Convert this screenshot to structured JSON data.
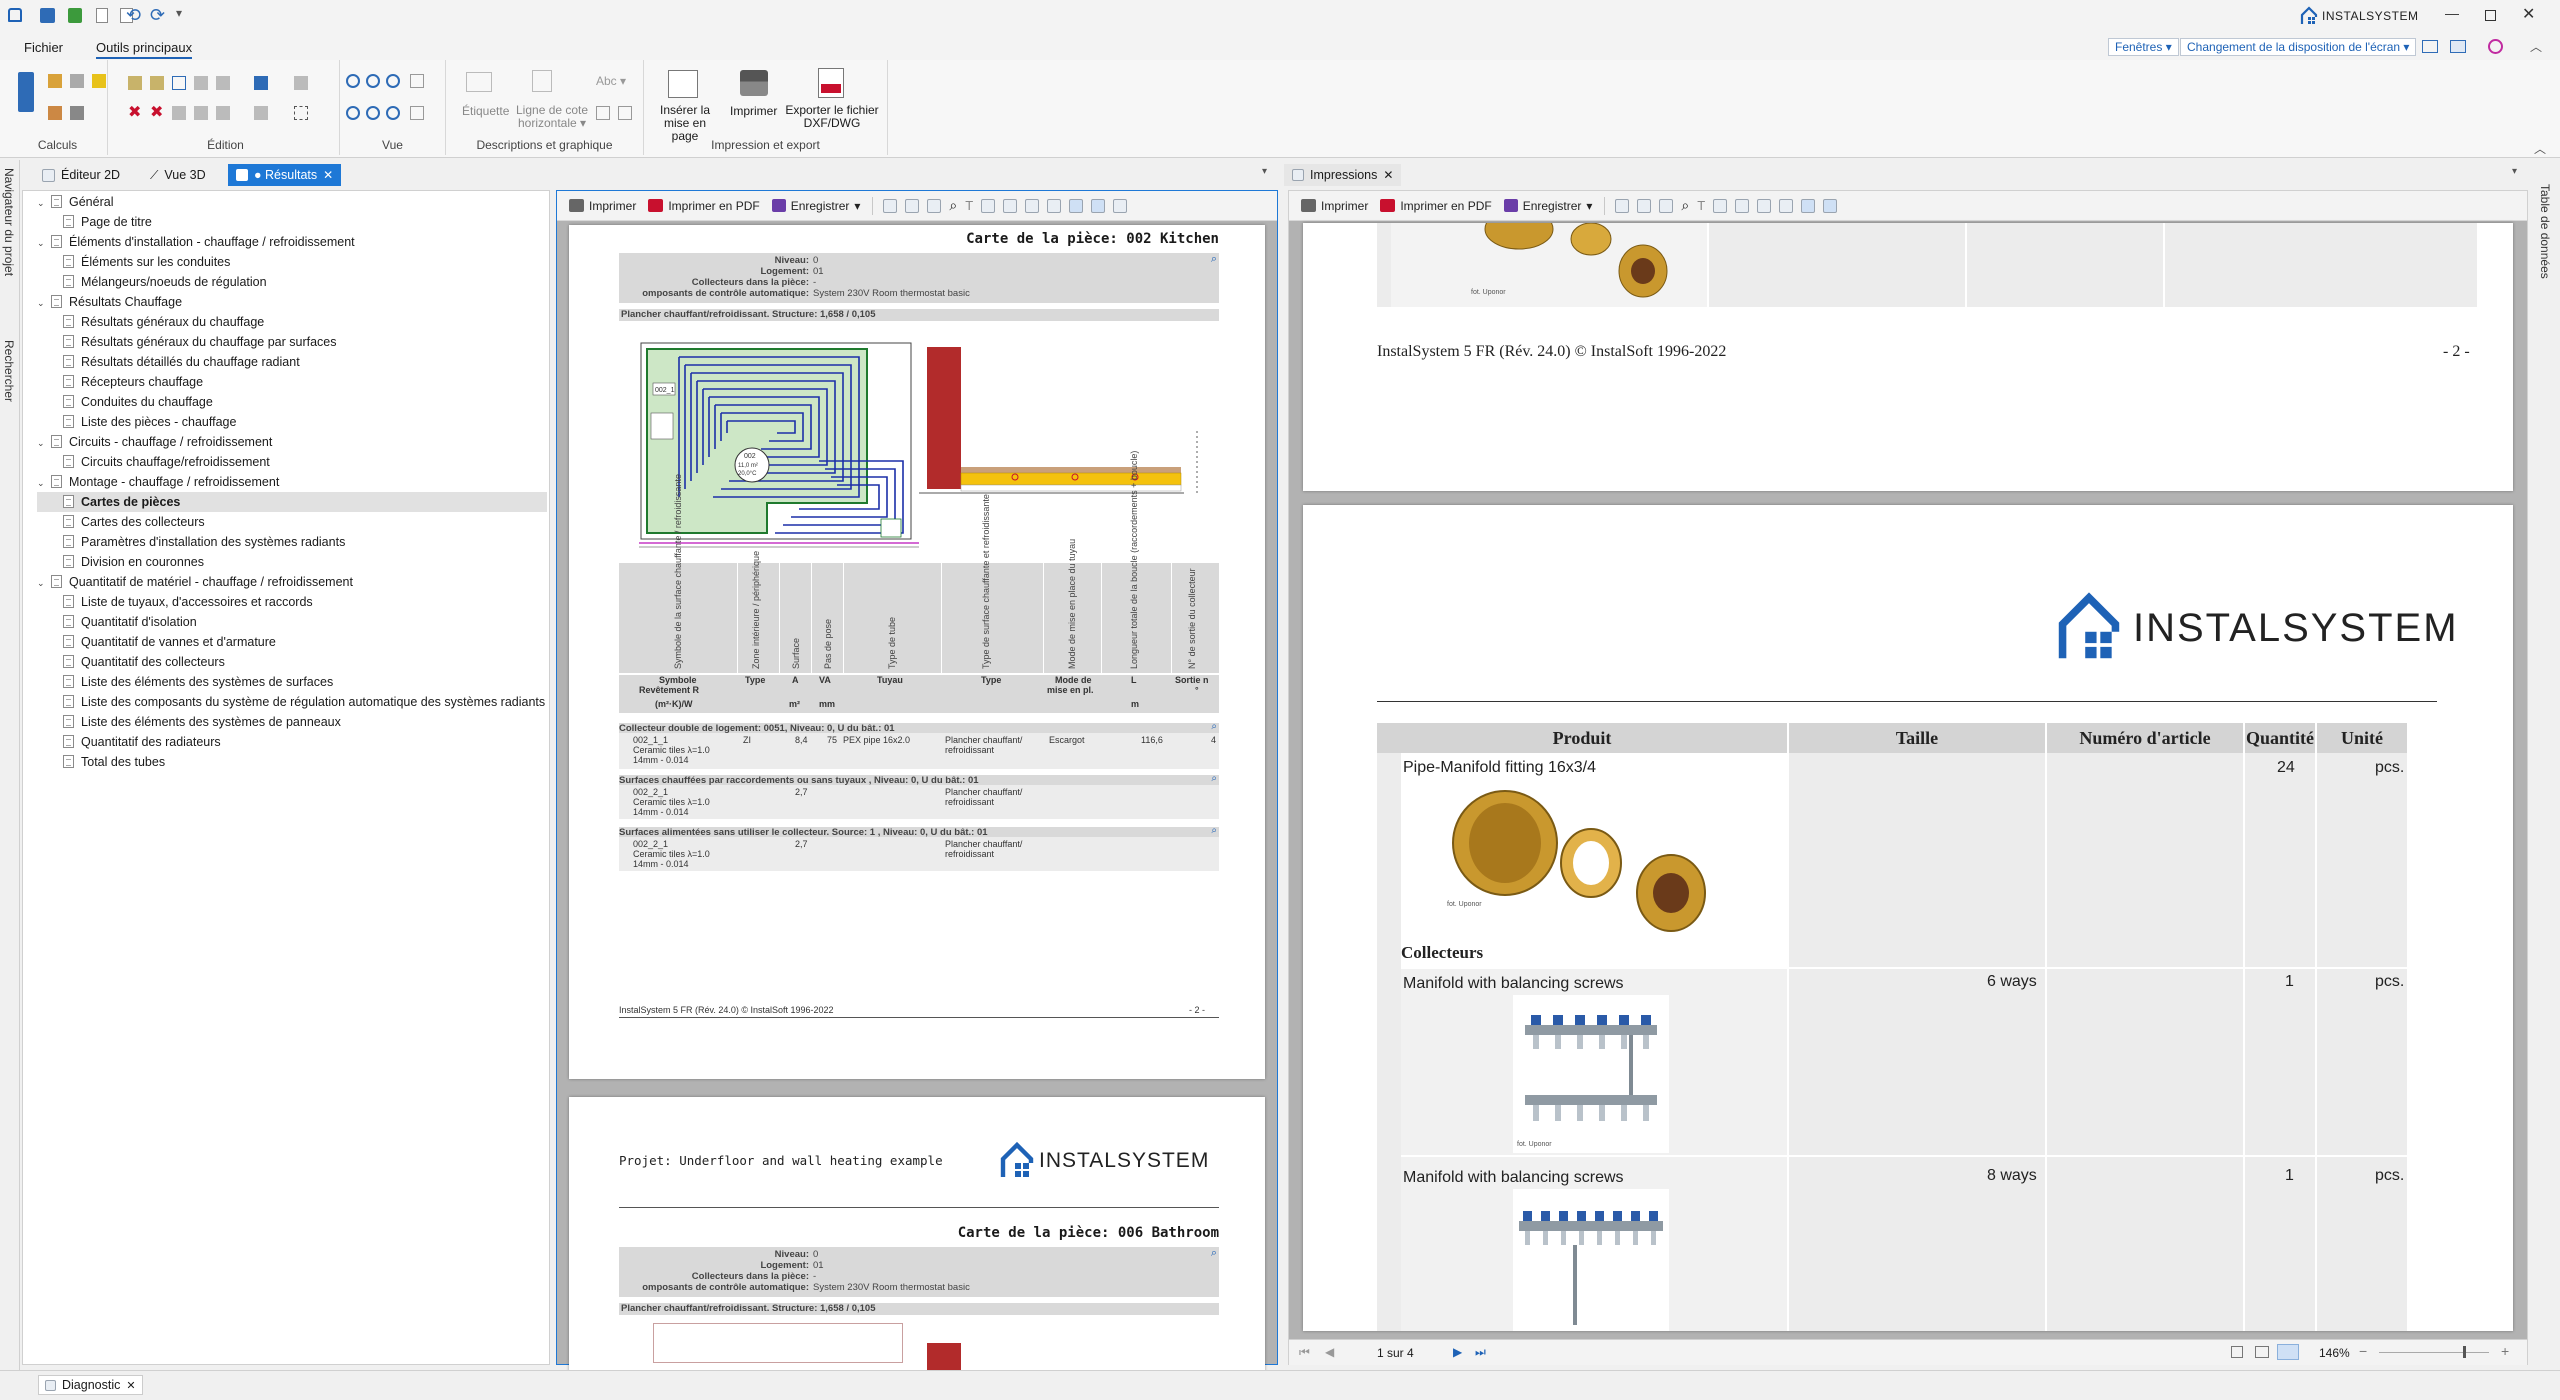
{
  "app": {
    "brand": "INSTALSYSTEM",
    "brand_prefix": "INSTAL",
    "brand_suffix": "SYSTEM"
  },
  "menu": {
    "file": "Fichier",
    "main_tools": "Outils principaux"
  },
  "ribbon": {
    "windows": "Fenêtres",
    "layout_change": "Changement de la disposition de l'écran",
    "groups": {
      "calculs": "Calculs",
      "edition": "Édition",
      "vue": "Vue",
      "descriptions": "Descriptions et graphique",
      "impression": "Impression et export"
    },
    "etiquette": "Étiquette",
    "ligne_cote": "Ligne de cote",
    "horizontale": "horizontale",
    "inserer": "Insérer la",
    "mise_en_page": "mise en page",
    "imprimer": "Imprimer",
    "exporter": "Exporter le fichier",
    "dxf": "DXF/DWG"
  },
  "tabs": {
    "editor2d": "Éditeur 2D",
    "vue3d": "Vue 3D",
    "resultats": "● Résultats",
    "impressions": "Impressions"
  },
  "side": {
    "navigator": "Navigateur du projet",
    "search": "Rechercher",
    "data_table": "Table de données"
  },
  "toolbar": {
    "print": "Imprimer",
    "print_pdf": "Imprimer en PDF",
    "save": "Enregistrer"
  },
  "tree": [
    {
      "label": "Général",
      "level": 0
    },
    {
      "label": "Page de titre",
      "level": 1
    },
    {
      "label": "Éléments d'installation - chauffage / refroidissement",
      "level": 0
    },
    {
      "label": "Éléments sur les conduites",
      "level": 1
    },
    {
      "label": "Mélangeurs/noeuds de régulation",
      "level": 1
    },
    {
      "label": "Résultats Chauffage",
      "level": 0
    },
    {
      "label": "Résultats généraux du chauffage",
      "level": 1
    },
    {
      "label": "Résultats généraux du chauffage par surfaces",
      "level": 1
    },
    {
      "label": "Résultats détaillés du chauffage radiant",
      "level": 1
    },
    {
      "label": "Récepteurs chauffage",
      "level": 1
    },
    {
      "label": "Conduites du chauffage",
      "level": 1
    },
    {
      "label": "Liste des pièces - chauffage",
      "level": 1
    },
    {
      "label": "Circuits - chauffage / refroidissement",
      "level": 0
    },
    {
      "label": "Circuits chauffage/refroidissement",
      "level": 1
    },
    {
      "label": "Montage - chauffage / refroidissement",
      "level": 0
    },
    {
      "label": "Cartes de pièces",
      "level": 1,
      "selected": true
    },
    {
      "label": "Cartes des collecteurs",
      "level": 1
    },
    {
      "label": "Paramètres d'installation des systèmes radiants",
      "level": 1
    },
    {
      "label": "Division en couronnes",
      "level": 1
    },
    {
      "label": "Quantitatif de matériel - chauffage / refroidissement",
      "level": 0
    },
    {
      "label": "Liste de tuyaux, d'accessoires et raccords",
      "level": 1
    },
    {
      "label": "Quantitatif d'isolation",
      "level": 1
    },
    {
      "label": "Quantitatif de vannes et d'armature",
      "level": 1
    },
    {
      "label": "Quantitatif des collecteurs",
      "level": 1
    },
    {
      "label": "Liste des éléments des systèmes de surfaces",
      "level": 1
    },
    {
      "label": "Liste des composants du système de régulation automatique des systèmes radiants",
      "level": 1
    },
    {
      "label": "Liste des éléments des systèmes de panneaux",
      "level": 1
    },
    {
      "label": "Quantitatif des radiateurs",
      "level": 1
    },
    {
      "label": "Total des tubes",
      "level": 1
    }
  ],
  "room_card1": {
    "title": "Carte de la pièce: 002 Kitchen",
    "niveau_label": "Niveau:",
    "niveau": "0",
    "logement_label": "Logement:",
    "logement": "01",
    "collecteurs_label": "Collecteurs dans la pièce:",
    "collecteurs": "-",
    "composants_label": "omposants de contrôle automatique:",
    "composants": "System 230V Room thermostat basic",
    "structure": "Plancher chauffant/refroidissant. Structure: 1,658 / 0,105",
    "col_symbol": "Symbole de la surface chauffante / refroidissante",
    "col_zone": "Zone intérieure / périphérique",
    "col_surface": "Surface",
    "col_pas": "Pas de pose",
    "col_tube": "Type de tube",
    "col_typesurf": "Type de surface chauffante et refroidissante",
    "col_mode": "Mode de mise en place du tuyau",
    "col_long": "Longueur totale de la boucle (raccordements + boucle)",
    "col_sortie": "N° de sortie du collecteur",
    "h_symbole": "Symbole",
    "h_revetement": "Revêtement R",
    "h_unit": "(m²·K)/W",
    "h_type": "Type",
    "h_a": "A",
    "h_m2": "m²",
    "h_va": "VA",
    "h_mm": "mm",
    "h_tuyau": "Tuyau",
    "h_type2": "Type",
    "h_mode": "Mode de",
    "h_mise": "mise en pl.",
    "h_l": "L",
    "h_m": "m",
    "h_sortie": "Sortie n",
    "h_star": "°",
    "sec1": "Collecteur double de logement: 0051, Niveau: 0, U du bât.: 01",
    "r1_sym": "002_1_1",
    "r1_cer": "Ceramic tiles λ=1.0",
    "r1_mm": "14mm - 0.014",
    "r1_zone": "ZI",
    "r1_a": "8,4",
    "r1_va": "75",
    "r1_tube": "PEX pipe 16x2.0",
    "r1_type": "Plancher chauffant/",
    "r1_type2": "refroidissant",
    "r1_mode": "Escargot",
    "r1_l": "116,6",
    "r1_sortie": "4",
    "sec2": "Surfaces chauffées par raccordements ou sans tuyaux , Niveau: 0, U du bât.: 01",
    "r2_sym": "002_2_1",
    "r2_cer": "Ceramic tiles λ=1.0",
    "r2_mm": "14mm - 0.014",
    "r2_a": "2,7",
    "r2_type": "Plancher chauffant/",
    "r2_type2": "refroidissant",
    "sec3": "Surfaces alimentées sans utiliser le collecteur. Source: 1 , Niveau: 0, U du bât.: 01",
    "r3_sym": "002_2_1",
    "r3_cer": "Ceramic tiles λ=1.0",
    "r3_mm": "14mm - 0.014",
    "r3_a": "2,7",
    "r3_type": "Plancher chauffant/",
    "r3_type2": "refroidissant",
    "footer": "InstalSystem 5 FR (Rév. 24.0) © InstalSoft 1996-2022",
    "page": "- 2 -",
    "plan_lbl1": "002_1",
    "plan_lbl2": "002",
    "plan_lbl3": "11,0 m²",
    "plan_lbl4": "20,0°C"
  },
  "room_card2": {
    "project": "Projet: Underfloor and wall heating example",
    "title": "Carte de la pièce: 006 Bathroom",
    "niveau_label": "Niveau:",
    "niveau": "0",
    "logement_label": "Logement:",
    "logement": "01",
    "collecteurs_label": "Collecteurs dans la pièce:",
    "collecteurs": "-",
    "composants_label": "omposants de contrôle automatique:",
    "composants": "System 230V Room thermostat basic",
    "structure": "Plancher chauffant/refroidissant. Structure: 1,658 / 0,105"
  },
  "print_page1": {
    "footer": "InstalSystem 5 FR (Rév. 24.0) © InstalSoft 1996-2022",
    "page": "- 2 -",
    "img_credit": "fot. Uponor"
  },
  "products": {
    "h_produit": "Produit",
    "h_taille": "Taille",
    "h_numero": "Numéro d'article",
    "h_quantite": "Quantité",
    "h_unite": "Unité",
    "row1_name": "Pipe-Manifold fitting 16x3/4",
    "row1_qty": "24",
    "row1_unit": "pcs.",
    "row1_credit": "fot. Uponor",
    "section": "Collecteurs",
    "row2_name": "Manifold with balancing screws",
    "row2_size": "6 ways",
    "row2_qty": "1",
    "row2_unit": "pcs.",
    "row2_credit": "fot. Uponor",
    "row3_name": "Manifold with balancing screws",
    "row3_size": "8 ways",
    "row3_qty": "1",
    "row3_unit": "pcs."
  },
  "status": {
    "page": "1 sur 4",
    "zoom": "146%",
    "diagnostic": "Diagnostic"
  },
  "colors": {
    "accent": "#1e62b6",
    "tab_active": "#1e78d6",
    "wall_red": "#b22b2b",
    "pipe_blue": "#1c2fa8",
    "screed_yellow": "#f4c20d",
    "zone_green": "#1f7a2e"
  }
}
